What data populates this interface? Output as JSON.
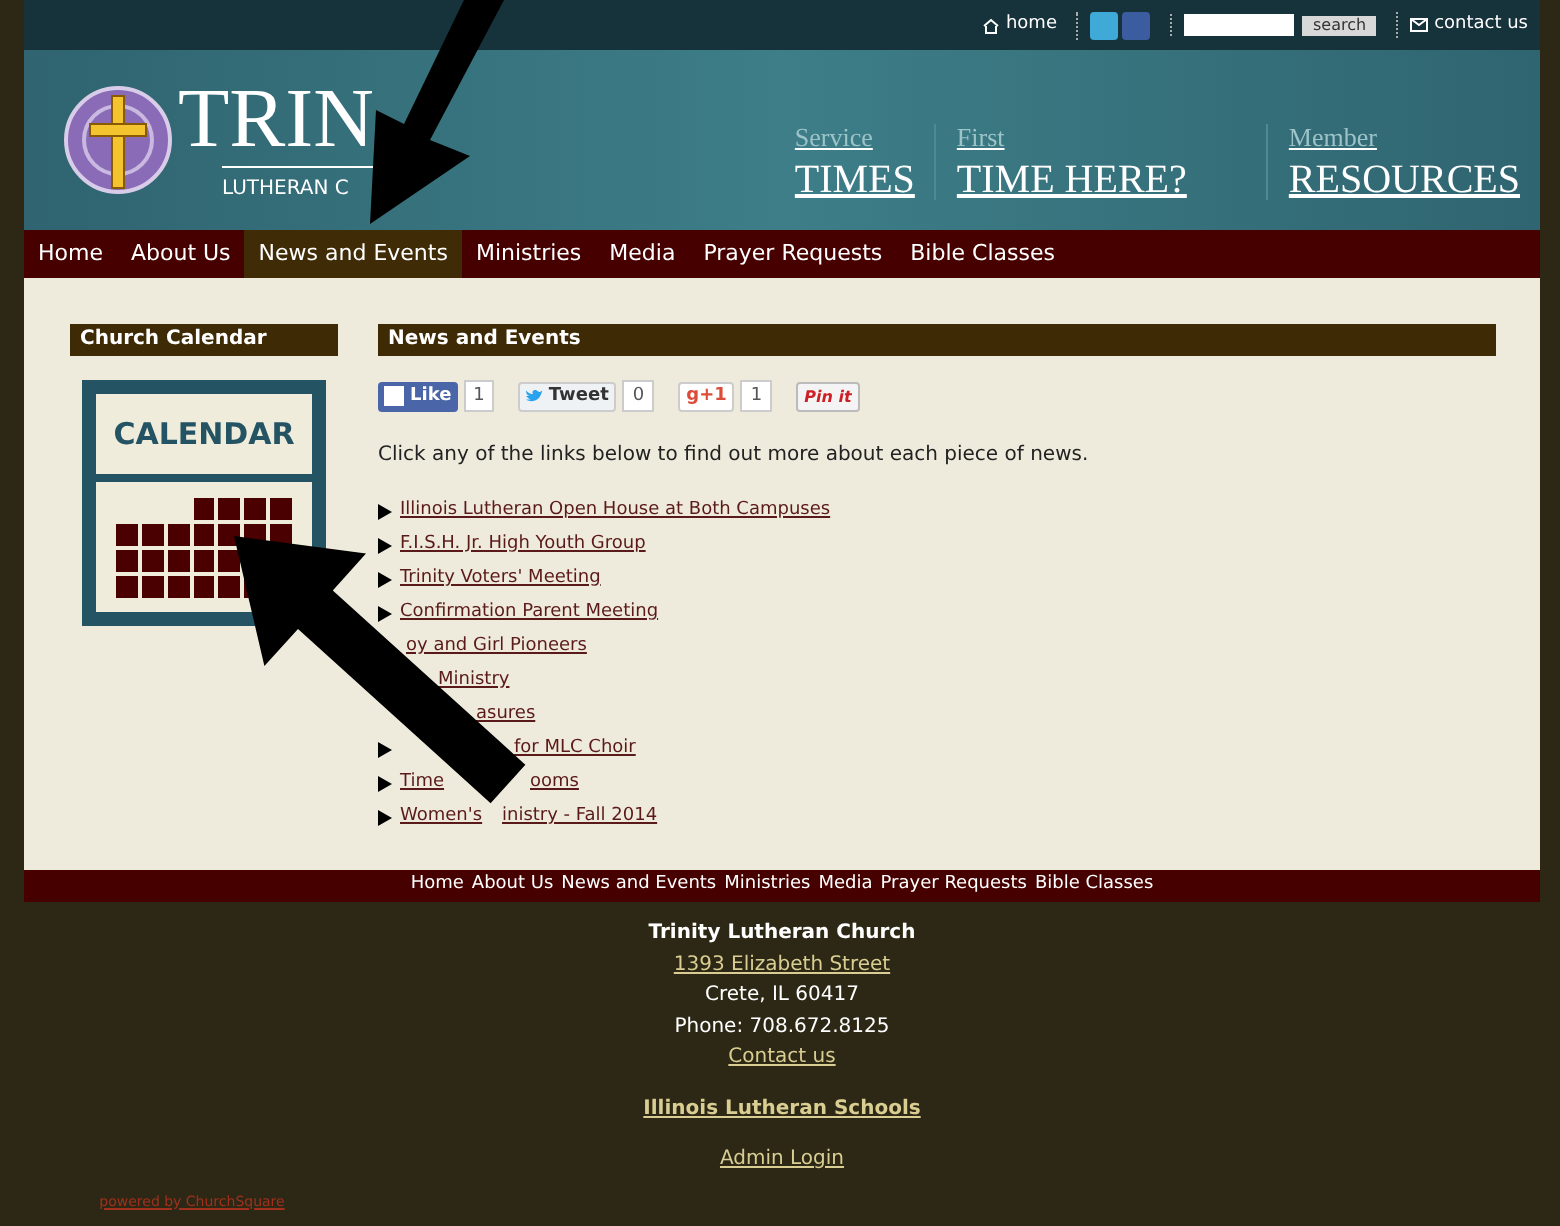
{
  "top_bar": {
    "home": "home",
    "search_button": "search",
    "contact": "contact us"
  },
  "logo": {
    "title": "TRIN",
    "subtitle": "LUTHERAN C"
  },
  "header_links": [
    {
      "small": "Service",
      "big": "TIMES"
    },
    {
      "small": "First",
      "big": "TIME HERE?"
    },
    {
      "small": "Member",
      "big": "RESOURCES"
    }
  ],
  "nav": [
    {
      "label": "Home",
      "selected": false
    },
    {
      "label": "About Us",
      "selected": false
    },
    {
      "label": "News and Events",
      "selected": true
    },
    {
      "label": "Ministries",
      "selected": false
    },
    {
      "label": "Media",
      "selected": false
    },
    {
      "label": "Prayer Requests",
      "selected": false
    },
    {
      "label": "Bible Classes",
      "selected": false
    }
  ],
  "sidebar": {
    "heading": "Church Calendar",
    "calendar_label": "CALENDAR"
  },
  "main": {
    "heading": "News and Events",
    "social": [
      {
        "kind": "like",
        "label": "Like",
        "count": "1"
      },
      {
        "kind": "tweet",
        "label": "Tweet",
        "count": "0"
      },
      {
        "kind": "plusone",
        "label": "g+1",
        "count": "1"
      },
      {
        "kind": "pin",
        "label": "Pin it"
      }
    ],
    "intro": "Click any of the links below to find out more about each piece of news.",
    "links": [
      {
        "bullet": true,
        "fragments": [
          "Illinois Lutheran Open House at Both Campuses"
        ]
      },
      {
        "bullet": true,
        "fragments": [
          "F.I.S.H. Jr. High Youth Group"
        ]
      },
      {
        "bullet": true,
        "fragments": [
          "Trinity Voters' Meeting"
        ]
      },
      {
        "bullet": true,
        "fragments": [
          "Confirmation Parent Meeting"
        ]
      },
      {
        "bullet": false,
        "fragments": [
          "oy and Girl Pioneers"
        ]
      },
      {
        "bullet": false,
        "fragments": [
          "Ministry"
        ]
      },
      {
        "bullet": false,
        "fragments": [
          "asures"
        ]
      },
      {
        "bullet": true,
        "fragments": [
          "for MLC Choir"
        ]
      },
      {
        "bullet": true,
        "fragments": [
          "Time",
          "ooms"
        ]
      },
      {
        "bullet": true,
        "fragments": [
          "Women's",
          "inistry - Fall 2014"
        ]
      }
    ]
  },
  "footer_nav": [
    "Home",
    "About Us",
    "News and Events",
    "Ministries",
    "Media",
    "Prayer Requests",
    "Bible Classes"
  ],
  "footer": {
    "name": "Trinity Lutheran Church",
    "street": "1393 Elizabeth Street",
    "city": "Crete, IL 60417",
    "phone": "Phone: 708.672.8125",
    "contact": "Contact us",
    "schools": "Illinois Lutheran Schools",
    "admin": "Admin Login",
    "powered": "powered by ChurchSquare"
  }
}
